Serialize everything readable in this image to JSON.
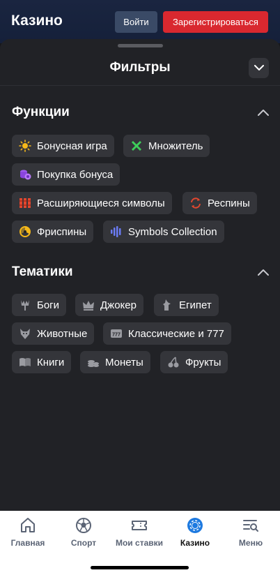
{
  "header": {
    "title": "Казино",
    "login_label": "Войти",
    "register_label": "Зарегистрироваться"
  },
  "sheet": {
    "title": "Фильтры"
  },
  "functions": {
    "title": "Функции",
    "chips": [
      {
        "label": "Бонусная игра",
        "icon": "sun-icon",
        "color": "#f5b81a"
      },
      {
        "label": "Множитель",
        "icon": "multiplier-x-icon",
        "color": "#3ecf5a"
      },
      {
        "label": "Покупка бонуса",
        "icon": "coins-bonus-icon",
        "color": "#a05cf0"
      },
      {
        "label": "Расширяющиеся символы",
        "icon": "expanding-symbols-icon",
        "color": "#e2472f"
      },
      {
        "label": "Респины",
        "icon": "respin-icon",
        "color": "#e2472f"
      },
      {
        "label": "Фриспины",
        "icon": "freespin-icon",
        "color": "#f5b81a"
      },
      {
        "label": "Symbols Collection",
        "icon": "symbols-collection-icon",
        "color": "#6b7cf5"
      }
    ]
  },
  "themes": {
    "title": "Тематики",
    "chips": [
      {
        "label": "Боги",
        "icon": "trident-icon"
      },
      {
        "label": "Джокер",
        "icon": "crown-icon"
      },
      {
        "label": "Египет",
        "icon": "anubis-icon"
      },
      {
        "label": "Животные",
        "icon": "wolf-icon"
      },
      {
        "label": "Классические и 777",
        "icon": "slot-777-icon"
      },
      {
        "label": "Книги",
        "icon": "book-icon"
      },
      {
        "label": "Монеты",
        "icon": "coins-icon"
      },
      {
        "label": "Фрукты",
        "icon": "cherry-icon"
      }
    ]
  },
  "nav": {
    "items": [
      {
        "label": "Главная",
        "icon": "home-icon",
        "active": false
      },
      {
        "label": "Спорт",
        "icon": "soccer-ball-icon",
        "active": false
      },
      {
        "label": "Мои ставки",
        "icon": "ticket-icon",
        "active": false
      },
      {
        "label": "Казино",
        "icon": "casino-chip-icon",
        "active": true
      },
      {
        "label": "Меню",
        "icon": "menu-search-icon",
        "active": false
      }
    ],
    "active_color": "#1e7ae0"
  }
}
